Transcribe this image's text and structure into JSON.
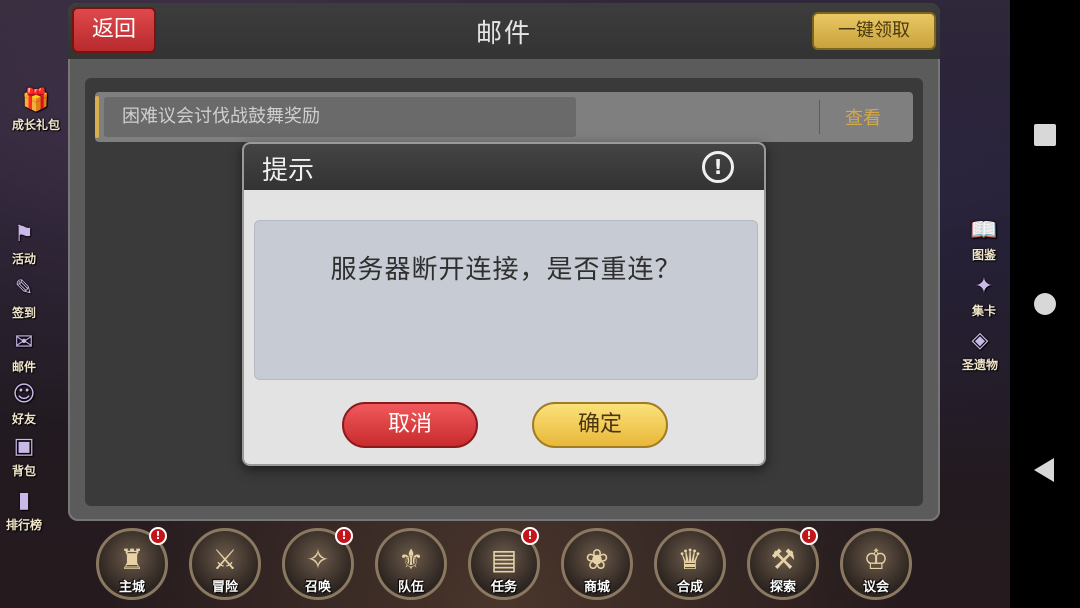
{
  "mail": {
    "title": "邮件",
    "back_label": "返回",
    "claim_all_label": "一键领取",
    "items": [
      {
        "subject": "困难议会讨伐战鼓舞奖励",
        "action_label": "查看"
      }
    ]
  },
  "dialog": {
    "title": "提示",
    "alert_glyph": "!",
    "message": "服务器断开连接，是否重连？",
    "cancel_label": "取消",
    "confirm_label": "确定"
  },
  "left_menu": [
    {
      "label": "成长礼包",
      "icon": "gift-icon"
    },
    {
      "label": "活动",
      "icon": "activity-icon"
    },
    {
      "label": "签到",
      "icon": "checkin-icon"
    },
    {
      "label": "邮件",
      "icon": "mail-icon"
    },
    {
      "label": "好友",
      "icon": "friends-icon"
    },
    {
      "label": "背包",
      "icon": "bag-icon"
    },
    {
      "label": "排行榜",
      "icon": "ranking-icon"
    }
  ],
  "right_menu": [
    {
      "label": "图鉴",
      "icon": "book-icon"
    },
    {
      "label": "集卡",
      "icon": "card-icon"
    },
    {
      "label": "圣遗物",
      "icon": "relic-icon"
    }
  ],
  "bottom_nav": [
    {
      "label": "主城",
      "icon": "castle-icon",
      "badge": "!"
    },
    {
      "label": "冒险",
      "icon": "axe-icon",
      "badge": ""
    },
    {
      "label": "召唤",
      "icon": "summon-icon",
      "badge": "!"
    },
    {
      "label": "队伍",
      "icon": "team-icon",
      "badge": ""
    },
    {
      "label": "任务",
      "icon": "quest-icon",
      "badge": "!"
    },
    {
      "label": "商城",
      "icon": "shop-icon",
      "badge": ""
    },
    {
      "label": "合成",
      "icon": "craft-icon",
      "badge": ""
    },
    {
      "label": "探索",
      "icon": "explore-icon",
      "badge": "!"
    },
    {
      "label": "议会",
      "icon": "council-icon",
      "badge": ""
    }
  ],
  "colors": {
    "accent_gold": "#d4a94a",
    "button_red": "#c82b2e",
    "button_yellow": "#e8b83a"
  }
}
